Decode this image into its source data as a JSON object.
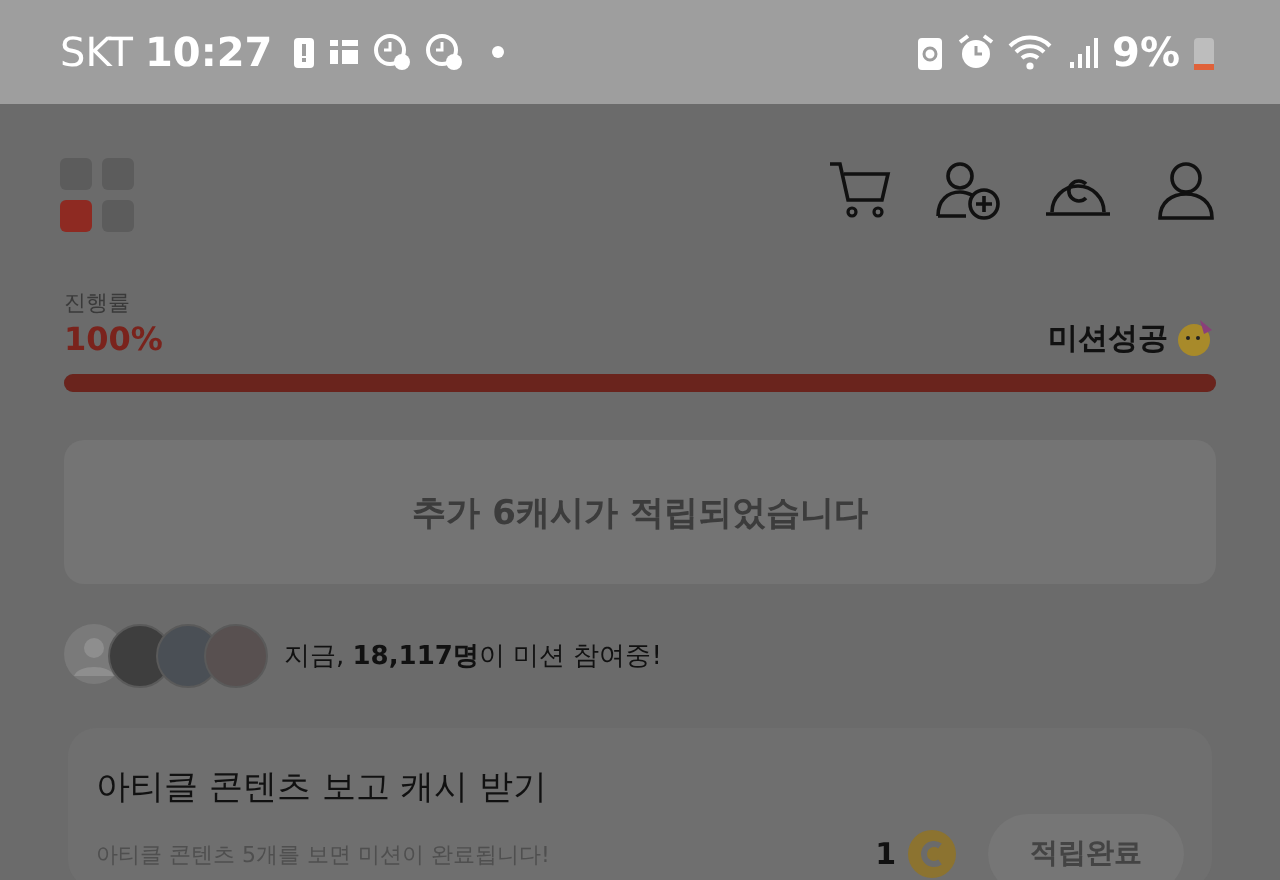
{
  "status_bar": {
    "carrier": "SKT",
    "time": "10:27",
    "battery": "9%"
  },
  "progress": {
    "label": "진행률",
    "value": "100%",
    "level": 1,
    "result": "미션성공"
  },
  "notice": "추가 6캐시가 적립되었습니다",
  "participants": {
    "text": "지금,  **18,117명**이 미션 참여중!"
  },
  "mission": {
    "title": "아티클 콘텐츠 보고 캐시 받기",
    "description": "아티클 콘텐츠 5개를 보면 미션이 완료됩니다!",
    "reward": "1",
    "button": "적립완료",
    "disabled": true
  }
}
